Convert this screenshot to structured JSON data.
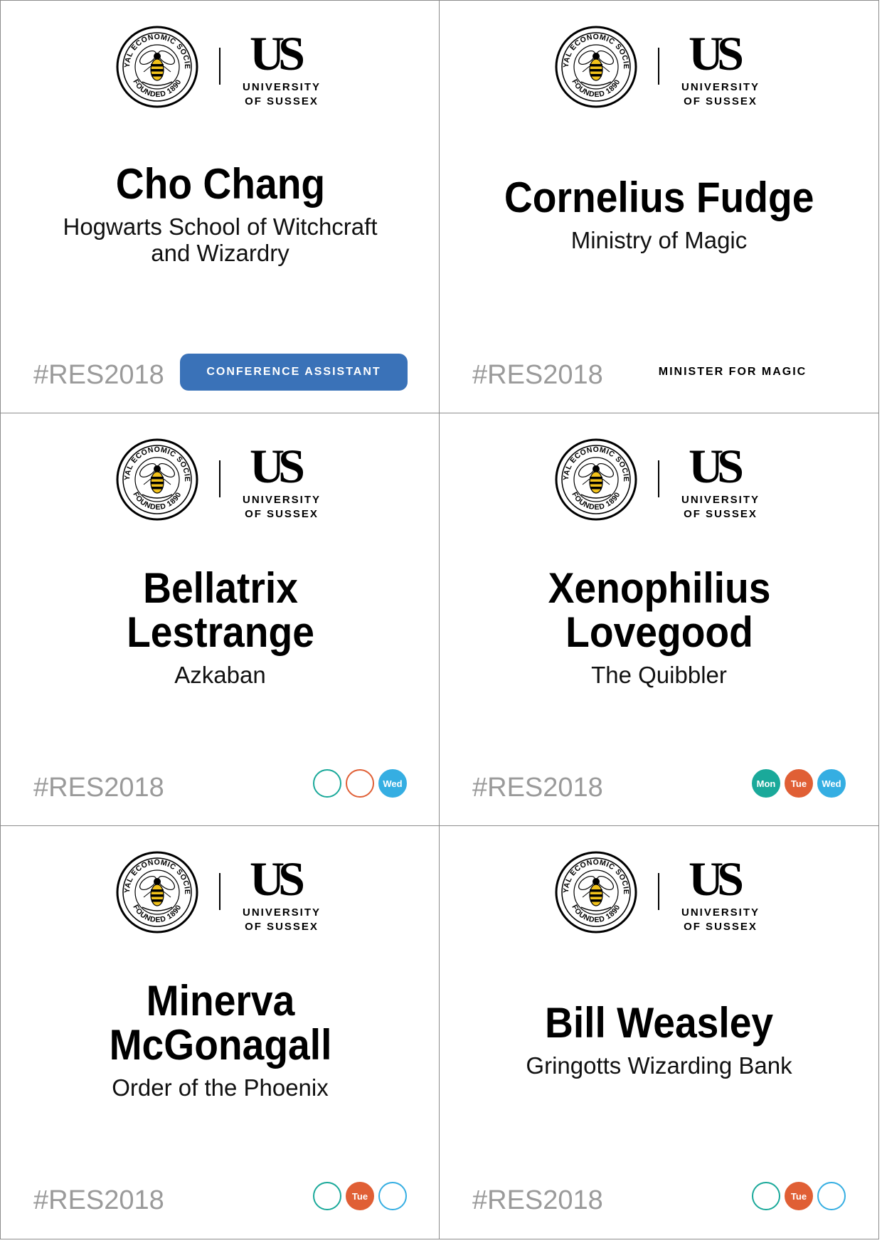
{
  "hashtag": "#RES2018",
  "logos": {
    "res_seal_top": "ROYAL ECONOMIC SOCIETY",
    "res_seal_bottom": "FOUNDED 1890",
    "university_mark": "US",
    "university_line1": "UNIVERSITY",
    "university_line2": "OF SUSSEX"
  },
  "colors": {
    "pill_blue": "#3a72b8",
    "mon": "#1aa99a",
    "tue": "#e05f35",
    "wed": "#35aee2",
    "hashtag_gray": "#9a9a9a"
  },
  "badges": [
    {
      "name": "Cho Chang",
      "org": "Hogwarts School of Witchcraft and Wizardry",
      "role": "CONFERENCE ASSISTANT",
      "role_style": "pill",
      "days": []
    },
    {
      "name": "Cornelius Fudge",
      "org": "Ministry of Magic",
      "role": "MINISTER FOR MAGIC",
      "role_style": "plain",
      "days": []
    },
    {
      "name": "Bellatrix Lestrange",
      "org": "Azkaban",
      "role": "",
      "role_style": "",
      "days": [
        {
          "label": "",
          "color": "#1aa99a",
          "filled": false
        },
        {
          "label": "",
          "color": "#e05f35",
          "filled": false
        },
        {
          "label": "Wed",
          "color": "#35aee2",
          "filled": true
        }
      ]
    },
    {
      "name": "Xenophilius Lovegood",
      "org": "The Quibbler",
      "role": "",
      "role_style": "",
      "days": [
        {
          "label": "Mon",
          "color": "#1aa99a",
          "filled": true
        },
        {
          "label": "Tue",
          "color": "#e05f35",
          "filled": true
        },
        {
          "label": "Wed",
          "color": "#35aee2",
          "filled": true
        }
      ]
    },
    {
      "name": "Minerva McGonagall",
      "org": "Order of the Phoenix",
      "role": "",
      "role_style": "",
      "days": [
        {
          "label": "",
          "color": "#1aa99a",
          "filled": false
        },
        {
          "label": "Tue",
          "color": "#e05f35",
          "filled": true
        },
        {
          "label": "",
          "color": "#35aee2",
          "filled": false
        }
      ]
    },
    {
      "name": "Bill Weasley",
      "org": "Gringotts Wizarding Bank",
      "role": "",
      "role_style": "",
      "days": [
        {
          "label": "",
          "color": "#1aa99a",
          "filled": false
        },
        {
          "label": "Tue",
          "color": "#e05f35",
          "filled": true
        },
        {
          "label": "",
          "color": "#35aee2",
          "filled": false
        }
      ]
    }
  ]
}
